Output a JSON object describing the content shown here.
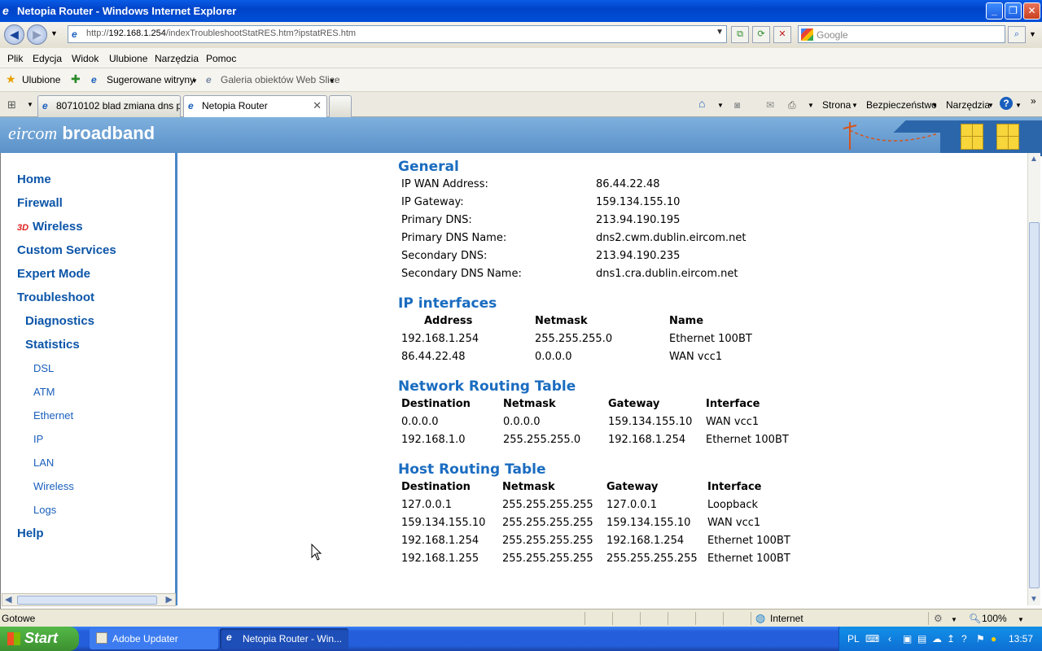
{
  "window": {
    "title": "Netopia Router - Windows Internet Explorer"
  },
  "address": {
    "url_prefix": "http://",
    "url_host": "192.168.1.254",
    "url_path": "/indexTroubleshootStatRES.htm?ipstatRES.htm",
    "search_placeholder": "Google"
  },
  "menu": [
    "Plik",
    "Edycja",
    "Widok",
    "Ulubione",
    "Narzędzia",
    "Pomoc"
  ],
  "favorites": {
    "favorites_label": "Ulubione",
    "suggested_sites": "Sugerowane witryny",
    "web_slice_gallery": "Galeria obiektów Web Slice"
  },
  "tabs": [
    {
      "label": "80710102 blad zmiana dns p..."
    },
    {
      "label": "Netopia Router"
    }
  ],
  "commandbar": {
    "page": "Strona",
    "security": "Bezpieczeństwo",
    "tools": "Narzędzia"
  },
  "banner": {
    "brand_italic": "eircom",
    "brand_bold": "broadband"
  },
  "sidebar": {
    "home": "Home",
    "firewall": "Firewall",
    "wireless_badge": "3D",
    "wireless": "Wireless",
    "custom_services": "Custom Services",
    "expert_mode": "Expert Mode",
    "troubleshoot": "Troubleshoot",
    "diagnostics": "Diagnostics",
    "statistics": "Statistics",
    "stats_items": [
      "DSL",
      "ATM",
      "Ethernet",
      "IP",
      "LAN",
      "Wireless",
      "Logs"
    ],
    "help": "Help"
  },
  "general": {
    "title": "General",
    "rows": [
      {
        "label": "IP WAN Address:",
        "value": "86.44.22.48"
      },
      {
        "label": "IP Gateway:",
        "value": "159.134.155.10"
      },
      {
        "label": "Primary DNS:",
        "value": "213.94.190.195"
      },
      {
        "label": "Primary DNS Name:",
        "value": "dns2.cwm.dublin.eircom.net"
      },
      {
        "label": "Secondary DNS:",
        "value": "213.94.190.235"
      },
      {
        "label": "Secondary DNS Name:",
        "value": "dns1.cra.dublin.eircom.net"
      }
    ]
  },
  "ip_interfaces": {
    "title": "IP interfaces",
    "headers": [
      "Address",
      "Netmask",
      "Name"
    ],
    "rows": [
      [
        "192.168.1.254",
        "255.255.255.0",
        "Ethernet 100BT"
      ],
      [
        "86.44.22.48",
        "0.0.0.0",
        "WAN vcc1"
      ]
    ]
  },
  "network_routing": {
    "title": "Network Routing Table",
    "headers": [
      "Destination",
      "Netmask",
      "Gateway",
      "Interface"
    ],
    "rows": [
      [
        "0.0.0.0",
        "0.0.0.0",
        "159.134.155.10",
        "WAN vcc1"
      ],
      [
        "192.168.1.0",
        "255.255.255.0",
        "192.168.1.254",
        "Ethernet 100BT"
      ]
    ]
  },
  "host_routing": {
    "title": "Host Routing Table",
    "headers": [
      "Destination",
      "Netmask",
      "Gateway",
      "Interface"
    ],
    "rows": [
      [
        "127.0.0.1",
        "255.255.255.255",
        "127.0.0.1",
        "Loopback"
      ],
      [
        "159.134.155.10",
        "255.255.255.255",
        "159.134.155.10",
        "WAN vcc1"
      ],
      [
        "192.168.1.254",
        "255.255.255.255",
        "192.168.1.254",
        "Ethernet 100BT"
      ],
      [
        "192.168.1.255",
        "255.255.255.255",
        "255.255.255.255",
        "Ethernet 100BT"
      ]
    ]
  },
  "status": {
    "left": "Gotowe",
    "zone": "Internet",
    "zoom": "100%"
  },
  "taskbar": {
    "start": "Start",
    "tasks": [
      "Adobe Updater",
      "Netopia Router - Win..."
    ],
    "lang": "PL",
    "clock": "13:57"
  }
}
